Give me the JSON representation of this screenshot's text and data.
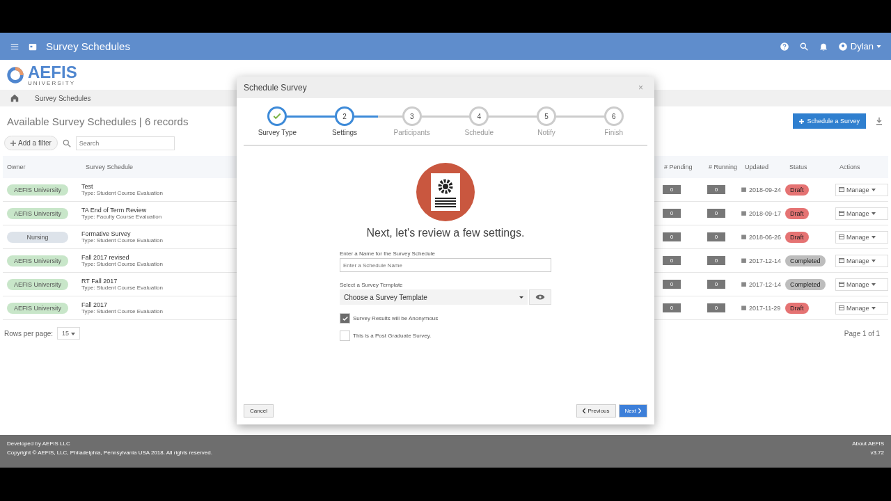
{
  "app_bar": {
    "title": "Survey Schedules",
    "user": "Dylan"
  },
  "logo": {
    "name": "AEFIS",
    "subtitle": "UNIVERSITY"
  },
  "breadcrumb": [
    "Survey Schedules"
  ],
  "page": {
    "heading": "Available Survey Schedules | 6 records",
    "primary_action": "Schedule a Survey",
    "filter_button": "Add a filter",
    "search_placeholder": "Search"
  },
  "table": {
    "columns": [
      "Owner",
      "Survey Schedule",
      "# Pending",
      "# Running",
      "Updated",
      "Status",
      "Actions"
    ],
    "rows": [
      {
        "owner": {
          "label": "AEFIS University",
          "color": "#c8e6c9"
        },
        "name": "Test",
        "type_label": "Type:",
        "type": "Student Course Evaluation",
        "pending": "0",
        "running": "0",
        "updated": "2018-09-24",
        "status": {
          "label": "Draft",
          "color": "#e57373"
        },
        "action": "Manage"
      },
      {
        "owner": {
          "label": "AEFIS University",
          "color": "#c8e6c9"
        },
        "name": "TA End of Term Review",
        "type_label": "Type:",
        "type": "Faculty Course Evaluation",
        "pending": "0",
        "running": "0",
        "updated": "2018-09-17",
        "status": {
          "label": "Draft",
          "color": "#e57373"
        },
        "action": "Manage"
      },
      {
        "owner": {
          "label": "Nursing",
          "color": "#dde3ea"
        },
        "name": "Formative Survey",
        "type_label": "Type:",
        "type": "Student Course Evaluation",
        "pending": "0",
        "running": "0",
        "updated": "2018-06-26",
        "status": {
          "label": "Draft",
          "color": "#e57373"
        },
        "action": "Manage"
      },
      {
        "owner": {
          "label": "AEFIS University",
          "color": "#c8e6c9"
        },
        "name": "Fall 2017 revised",
        "type_label": "Type:",
        "type": "Student Course Evaluation",
        "pending": "0",
        "running": "0",
        "updated": "2017-12-14",
        "status": {
          "label": "Completed",
          "color": "#bdbdbd"
        },
        "action": "Manage"
      },
      {
        "owner": {
          "label": "AEFIS University",
          "color": "#c8e6c9"
        },
        "name": "RT Fall 2017",
        "type_label": "Type:",
        "type": "Student Course Evaluation",
        "pending": "0",
        "running": "0",
        "updated": "2017-12-14",
        "status": {
          "label": "Completed",
          "color": "#bdbdbd"
        },
        "action": "Manage"
      },
      {
        "owner": {
          "label": "AEFIS University",
          "color": "#c8e6c9"
        },
        "name": "Fall 2017",
        "type_label": "Type:",
        "type": "Student Course Evaluation",
        "pending": "0",
        "running": "0",
        "updated": "2017-11-29",
        "status": {
          "label": "Draft",
          "color": "#e57373"
        },
        "action": "Manage"
      }
    ]
  },
  "pagination": {
    "rows_label": "Rows per page:",
    "rows_value": "15",
    "page": "Page 1 of 1"
  },
  "footer": {
    "developed": "Developed by",
    "company": "AEFIS LLC",
    "copyright": "Copyright © AEFIS, LLC, Philadelphia, Pennsylvania USA 2018. All rights reserved.",
    "about": "About AEFIS",
    "version": "v3.72"
  },
  "dialog": {
    "title": "Schedule Survey",
    "close": "×",
    "steps": [
      {
        "label": "Survey Type",
        "kind": "done"
      },
      {
        "number": "2",
        "label": "Settings",
        "kind": "current"
      },
      {
        "number": "3",
        "label": "Participants",
        "kind": "pending"
      },
      {
        "number": "4",
        "label": "Schedule",
        "kind": "pending"
      },
      {
        "number": "5",
        "label": "Notify",
        "kind": "pending"
      },
      {
        "number": "6",
        "label": "Finish",
        "kind": "pending"
      }
    ],
    "heading": "Next, let's review a few settings.",
    "name_label": "Enter a Name for the Survey Schedule",
    "name_placeholder": "Enter a Schedule Name",
    "template_label": "Select a Survey Template",
    "template_value": "Choose a Survey Template",
    "options": [
      {
        "label": "Survey Results will be Anonymous",
        "checked": true
      },
      {
        "label": "This is a Post Graduate Survey.",
        "checked": false
      }
    ],
    "cancel": "Cancel",
    "previous": "Previous",
    "next": "Next"
  }
}
